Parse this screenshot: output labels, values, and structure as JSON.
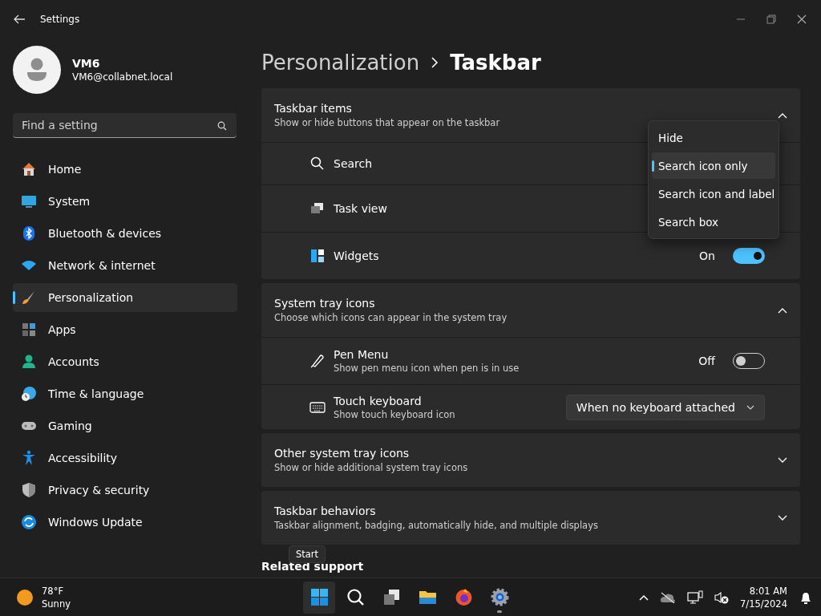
{
  "window": {
    "title": "Settings"
  },
  "account": {
    "name": "VM6",
    "email": "VM6@collabnet.local"
  },
  "search": {
    "placeholder": "Find a setting"
  },
  "nav": [
    {
      "label": "Home",
      "selected": false
    },
    {
      "label": "System",
      "selected": false
    },
    {
      "label": "Bluetooth & devices",
      "selected": false
    },
    {
      "label": "Network & internet",
      "selected": false
    },
    {
      "label": "Personalization",
      "selected": true
    },
    {
      "label": "Apps",
      "selected": false
    },
    {
      "label": "Accounts",
      "selected": false
    },
    {
      "label": "Time & language",
      "selected": false
    },
    {
      "label": "Gaming",
      "selected": false
    },
    {
      "label": "Accessibility",
      "selected": false
    },
    {
      "label": "Privacy & security",
      "selected": false
    },
    {
      "label": "Windows Update",
      "selected": false
    }
  ],
  "breadcrumb": [
    "Personalization",
    "Taskbar"
  ],
  "sections": [
    {
      "title": "Taskbar items",
      "subtitle": "Show or hide buttons that appear on the taskbar",
      "expanded": true,
      "rows": [
        {
          "kind": "plain",
          "label": "Search"
        },
        {
          "kind": "plain",
          "label": "Task view"
        },
        {
          "kind": "toggle",
          "label": "Widgets",
          "state_label": "On",
          "on": true
        }
      ]
    },
    {
      "title": "System tray icons",
      "subtitle": "Choose which icons can appear in the system tray",
      "expanded": true,
      "rows": [
        {
          "kind": "toggle",
          "label": "Pen Menu",
          "subtitle": "Show pen menu icon when pen is in use",
          "state_label": "Off",
          "on": false
        },
        {
          "kind": "dropdown",
          "label": "Touch keyboard",
          "subtitle": "Show touch keyboard icon",
          "value": "When no keyboard attached"
        }
      ]
    },
    {
      "title": "Other system tray icons",
      "subtitle": "Show or hide additional system tray icons",
      "expanded": false
    },
    {
      "title": "Taskbar behaviors",
      "subtitle": "Taskbar alignment, badging, automatically hide, and multiple displays",
      "expanded": false
    }
  ],
  "dropdown_menu": {
    "options": [
      {
        "label": "Hide",
        "selected": false
      },
      {
        "label": "Search icon only",
        "selected": true
      },
      {
        "label": "Search icon and label",
        "selected": false
      },
      {
        "label": "Search box",
        "selected": false
      }
    ]
  },
  "related": "Related support",
  "tooltip": "Start",
  "taskbar": {
    "weather": {
      "temperature": "78°F",
      "condition": "Sunny"
    },
    "apps": [
      {
        "hovered": true,
        "running": false
      },
      {
        "hovered": false,
        "running": false
      },
      {
        "hovered": false,
        "running": false
      },
      {
        "hovered": false,
        "running": false
      },
      {
        "hovered": false,
        "running": false
      },
      {
        "hovered": false,
        "running": true
      }
    ],
    "time": "8:01 AM",
    "date": "7/15/2024"
  }
}
